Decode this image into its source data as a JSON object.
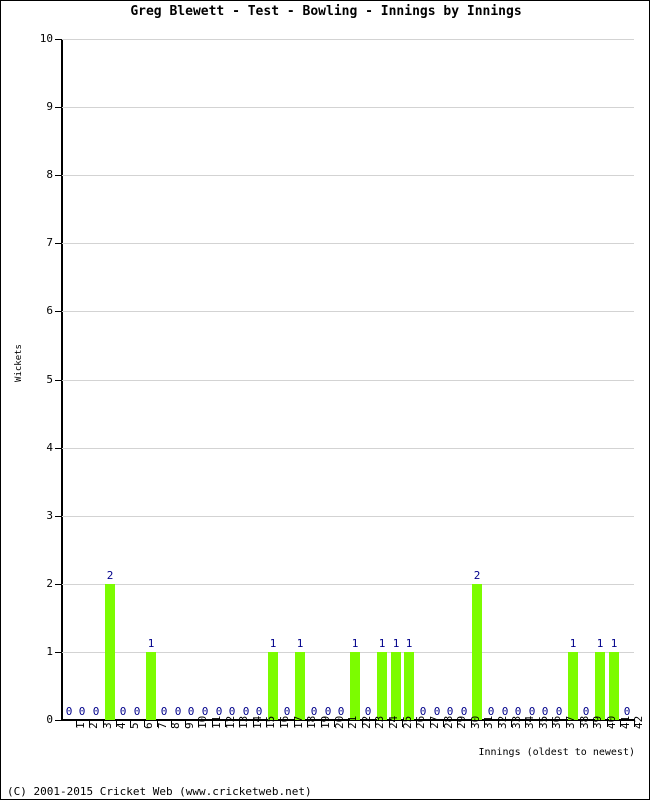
{
  "chart_data": {
    "type": "bar",
    "title": "Greg Blewett - Test - Bowling - Innings by Innings",
    "xlabel": "Innings (oldest to newest)",
    "ylabel": "Wickets",
    "ylim": [
      0,
      10
    ],
    "ytick_step": 1,
    "yticks": [
      "0",
      "1",
      "2",
      "3",
      "4",
      "5",
      "6",
      "7",
      "8",
      "9",
      "10"
    ],
    "grid": true,
    "legend": null,
    "bar_color": "#7CFC00",
    "value_label_color": "#00008B",
    "categories": [
      "1",
      "2",
      "3",
      "4",
      "5",
      "6",
      "7",
      "8",
      "9",
      "10",
      "11",
      "12",
      "13",
      "14",
      "15",
      "16",
      "17",
      "18",
      "19",
      "20",
      "21",
      "22",
      "23",
      "24",
      "25",
      "26",
      "27",
      "28",
      "29",
      "30",
      "31",
      "32",
      "33",
      "34",
      "35",
      "36",
      "37",
      "38",
      "39",
      "40",
      "41",
      "42"
    ],
    "values": [
      0,
      0,
      0,
      2,
      0,
      0,
      1,
      0,
      0,
      0,
      0,
      0,
      0,
      0,
      0,
      1,
      0,
      1,
      0,
      0,
      0,
      1,
      0,
      1,
      1,
      1,
      0,
      0,
      0,
      0,
      2,
      0,
      0,
      0,
      0,
      0,
      0,
      1,
      0,
      1,
      1,
      0
    ]
  },
  "footer": {
    "copyright": "(C) 2001-2015 Cricket Web (www.cricketweb.net)"
  }
}
